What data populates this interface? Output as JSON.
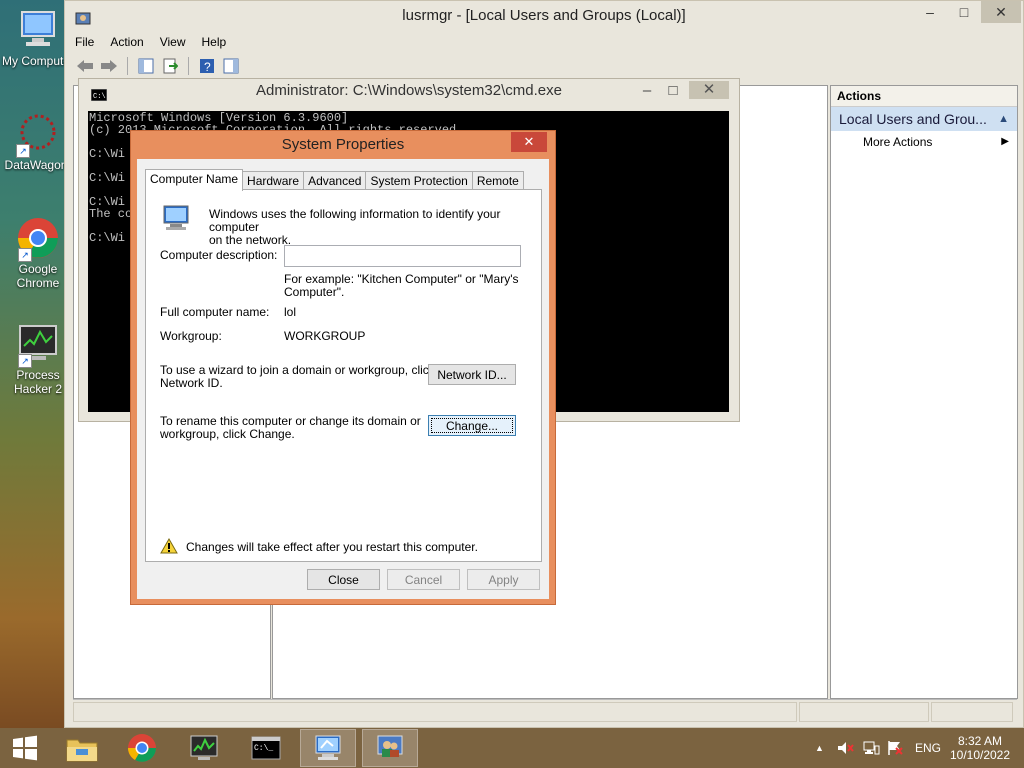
{
  "desktop": {
    "icons": [
      {
        "label": "My Compute"
      },
      {
        "label": "DataWagon"
      },
      {
        "label": "Google Chrome"
      },
      {
        "label": "Process Hacker 2"
      }
    ]
  },
  "mmc": {
    "title": "lusrmgr - [Local Users and Groups (Local)]",
    "menu": [
      "File",
      "Action",
      "View",
      "Help"
    ],
    "actions_header": "Actions",
    "actions_subheader": "Local Users and Grou...",
    "more_actions": "More Actions"
  },
  "cmd": {
    "title": "Administrator: C:\\Windows\\system32\\cmd.exe",
    "lines": [
      "Microsoft Windows [Version 6.3.9600]",
      "(c) 2013 Microsoft Corporation. All rights reserved.",
      "",
      "C:\\Wi",
      "",
      "C:\\Wi",
      "",
      "C:\\Wi",
      "The co",
      "",
      "C:\\Wi"
    ]
  },
  "sysprop": {
    "title": "System Properties",
    "tabs": [
      "Computer Name",
      "Hardware",
      "Advanced",
      "System Protection",
      "Remote"
    ],
    "info_text_1": "Windows uses the following information to identify your computer",
    "info_text_2": "on the network.",
    "description_label": "Computer description:",
    "description_value": "",
    "example_1": "For example: \"Kitchen Computer\" or \"Mary's",
    "example_2": "Computer\".",
    "full_name_label": "Full computer name:",
    "full_name_value": "lol",
    "workgroup_label": "Workgroup:",
    "workgroup_value": "WORKGROUP",
    "wizard_text_1": "To use a wizard to join a domain or workgroup, click",
    "wizard_text_2": "Network ID.",
    "network_id_button": "Network ID...",
    "rename_text_1": "To rename this computer or change its domain or",
    "rename_text_2": "workgroup, click Change.",
    "change_button": "Change...",
    "warning_text": "Changes will take effect after you restart this computer.",
    "close_button": "Close",
    "cancel_button": "Cancel",
    "apply_button": "Apply"
  },
  "taskbar": {
    "language": "ENG",
    "time": "8:32 AM",
    "date": "10/10/2022"
  }
}
